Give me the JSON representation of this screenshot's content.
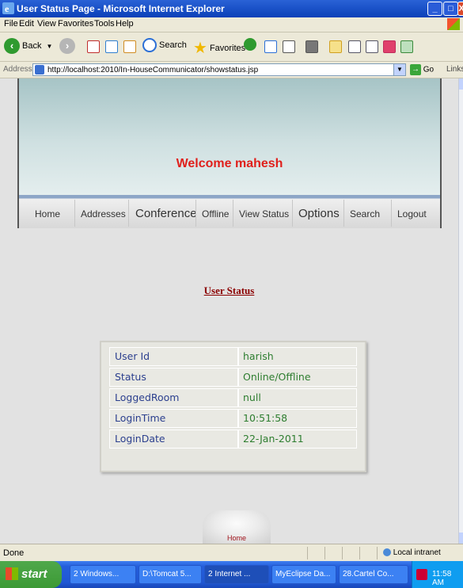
{
  "window": {
    "title": "User Status Page - Microsoft Internet Explorer",
    "controls": {
      "minimize": "_",
      "maximize": "□",
      "close": "X"
    }
  },
  "menu": [
    "File",
    "Edit",
    "View",
    "Favorites",
    "Tools",
    "Help"
  ],
  "toolbar": {
    "back": "Back",
    "search": "Search",
    "favorites": "Favorites"
  },
  "address": {
    "label": "Address",
    "url": "http://localhost:2010/In-HouseCommunicator/showstatus.jsp",
    "go": "Go",
    "links": "Links"
  },
  "page": {
    "welcome": "Welcome mahesh",
    "nav": [
      "Home",
      "Addresses",
      "Conference",
      "Offline",
      "View Status",
      "Options",
      "Search",
      "Logout"
    ],
    "section_title": "User Status",
    "status_rows": [
      {
        "key": "User Id",
        "value": "harish"
      },
      {
        "key": "Status",
        "value": "Online/Offline"
      },
      {
        "key": "LoggedRoom",
        "value": "null"
      },
      {
        "key": "LoginTime",
        "value": "10:51:58"
      },
      {
        "key": "LoginDate",
        "value": "22-Jan-2011"
      }
    ],
    "home_button": "Home"
  },
  "statusbar": {
    "text": "Done",
    "zone": "Local intranet"
  },
  "taskbar": {
    "start": "start",
    "tasks": [
      "2 Windows...",
      "D:\\Tomcat 5...",
      "2 Internet ...",
      "MyEclipse Da...",
      "28.Cartel Co..."
    ],
    "time": "11:58 AM"
  },
  "colors": {
    "welcome": "#e0201c",
    "section_title": "#8b0000",
    "table_key": "#2b3f8e",
    "table_value": "#2d7d2f",
    "titlebar": "#0a40b8"
  }
}
